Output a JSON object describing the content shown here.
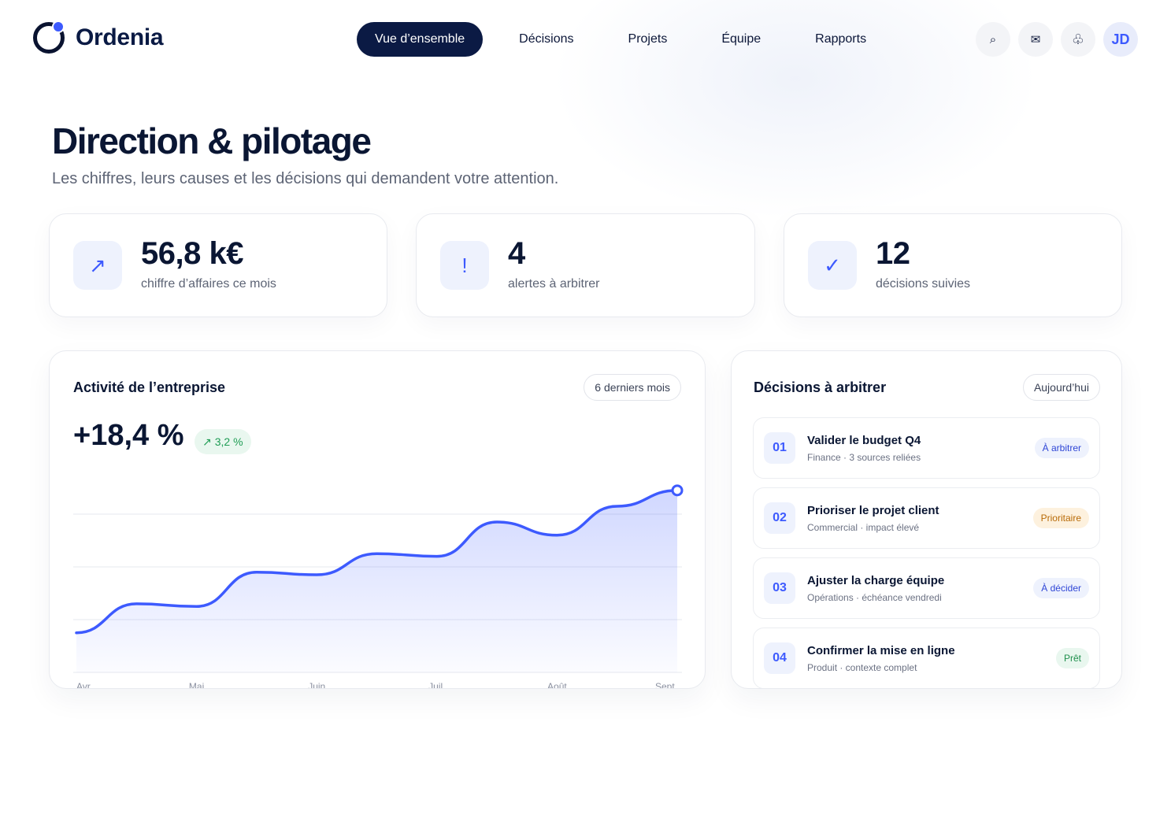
{
  "brand": {
    "name": "Ordenia",
    "accent": "#3d5afe",
    "navy": "#0b1a44"
  },
  "nav": {
    "items": [
      {
        "label": "Vue d’ensemble",
        "active": true
      },
      {
        "label": "Décisions"
      },
      {
        "label": "Projets"
      },
      {
        "label": "Équipe"
      },
      {
        "label": "Rapports"
      }
    ]
  },
  "header_actions": {
    "search_icon": "⌕",
    "mail_icon": "✉",
    "apps_icon": "♧",
    "avatar_initials": "JD"
  },
  "page": {
    "title": "Direction & pilotage",
    "subtitle": "Les chiffres, leurs causes et les décisions qui demandent votre attention."
  },
  "kpis": [
    {
      "icon": "↗",
      "icon_name": "trend-up-icon",
      "value": "56,8 k€",
      "label": "chiffre d’affaires ce mois"
    },
    {
      "icon": "!",
      "icon_name": "alert-icon",
      "value": "4",
      "label": "alertes à arbitrer"
    },
    {
      "icon": "✓",
      "icon_name": "check-icon",
      "value": "12",
      "label": "décisions suivies"
    }
  ],
  "activity": {
    "title": "Activité de l’entreprise",
    "period": "6 derniers mois",
    "growth": "+18,4 %",
    "delta_icon": "↗",
    "delta": "3,2 %"
  },
  "chart_data": {
    "type": "area",
    "title": "Activité de l’entreprise",
    "categories": [
      "Avr.",
      "Mai",
      "Juin",
      "Juil.",
      "Août",
      "Sept."
    ],
    "x": [
      0,
      0.5,
      1,
      1.5,
      2,
      2.5,
      3,
      3.5,
      4,
      4.5,
      5
    ],
    "y": [
      15,
      26,
      25,
      38,
      37,
      45,
      44,
      57,
      52,
      63,
      69
    ],
    "ylim": [
      0,
      80
    ],
    "grid": true,
    "legend": "none",
    "color": "#3d5afe"
  },
  "decisions": {
    "title": "Décisions à arbitrer",
    "period": "Aujourd’hui",
    "items": [
      {
        "num": "01",
        "title": "Valider le budget Q4",
        "sub": "Finance · 3 sources reliées",
        "badge": "À arbitrer",
        "tone": "blue"
      },
      {
        "num": "02",
        "title": "Prioriser le projet client",
        "sub": "Commercial · impact élevé",
        "badge": "Prioritaire",
        "tone": "amber"
      },
      {
        "num": "03",
        "title": "Ajuster la charge équipe",
        "sub": "Opérations · échéance vendredi",
        "badge": "À décider",
        "tone": "blue"
      },
      {
        "num": "04",
        "title": "Confirmer la mise en ligne",
        "sub": "Produit · contexte complet",
        "badge": "Prêt",
        "tone": "green"
      }
    ]
  }
}
